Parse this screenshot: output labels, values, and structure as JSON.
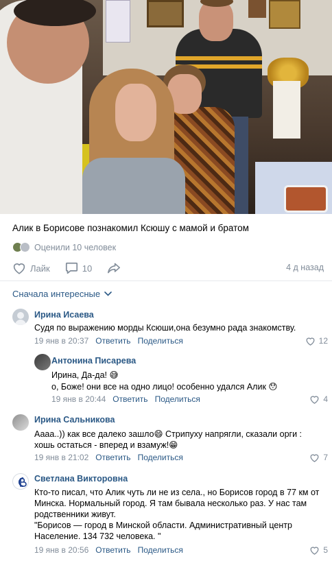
{
  "post": {
    "text": "Алик в Борисове познакомил Ксюшу с мамой и братом",
    "likers_text": "Оценили 10 человек",
    "like_label": "Лайк",
    "comments_count": "10",
    "time": "4 д назад"
  },
  "sort": {
    "label": "Сначала интересные"
  },
  "comments": [
    {
      "author": "Ирина Исаева",
      "text": "Судя по выражению морды Ксюши,она безумно рада знакомству.",
      "date": "19 янв в 20:37",
      "reply": "Ответить",
      "share": "Поделиться",
      "likes": "12"
    },
    {
      "author": "Антонина Писарева",
      "line1": "Ирина, Да-да! 😅",
      "line2": "о, Боже! они все на одно лицо! особенно удался Алик 😯",
      "date": "19 янв в 20:44",
      "reply": "Ответить",
      "share": "Поделиться",
      "likes": "4"
    },
    {
      "author": "Ирина Сальникова",
      "line1": "Аааа..)) как все далеко зашло😄 Стрипуху напрягли, сказали орги :",
      "line2": "хошь остаться - вперед и взамуж!😁",
      "date": "19 янв в 21:02",
      "reply": "Ответить",
      "share": "Поделиться",
      "likes": "7"
    },
    {
      "author": "Светлана Викторовна",
      "line1": "Кто-то писал, что Алик чуть ли не из села., но Борисов город в 77 км от",
      "line2": "Минска. Нормальный город. Я там бывала несколько раз. У нас там",
      "line3": "родственники живут.",
      "line4": "\"Борисов — город в Минской области. Административный центр",
      "line5": "Население. 134 732 человека. \"",
      "date": "19 янв в 20:56",
      "reply": "Ответить",
      "share": "Поделиться",
      "likes": "5"
    }
  ],
  "colors": {
    "link": "#2a5885",
    "muted": "#818c99",
    "divider": "#e7e8ec"
  },
  "icons": [
    "heart-icon",
    "comment-icon",
    "share-icon",
    "chevron-down-icon",
    "user-placeholder-icon"
  ]
}
